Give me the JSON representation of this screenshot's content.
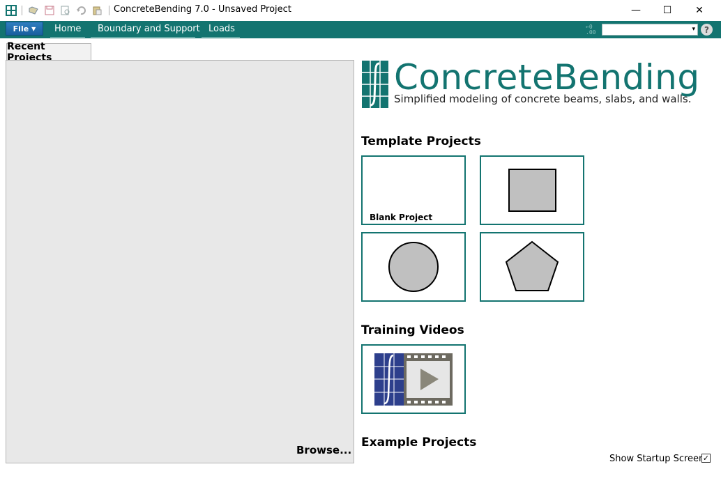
{
  "window": {
    "title": "ConcreteBending 7.0 - Unsaved Project",
    "minimize_glyph": "—",
    "maximize_glyph": "☐",
    "close_glyph": "✕"
  },
  "quick_access": [
    "app-icon",
    "open-icon",
    "save-icon",
    "print-preview-icon",
    "undo-icon",
    "paste-icon"
  ],
  "ribbon": {
    "file_label": "File",
    "tabs": [
      "Home",
      "Boundary and Support",
      "Loads"
    ],
    "units_combo_value": "",
    "help_glyph": "?",
    "decimal_glyph_top": "←0",
    "decimal_glyph_bottom": ".00",
    "accent_color": "#137470"
  },
  "recent": {
    "tab_label": "Recent Projects",
    "browse_label": "Browse..."
  },
  "logo": {
    "name": "ConcreteBending",
    "tagline": "Simplified modeling of concrete beams, slabs, and walls."
  },
  "templates": {
    "title": "Template Projects",
    "items": [
      {
        "label": "Blank Project",
        "shape": "none"
      },
      {
        "label": "",
        "shape": "rectangle"
      },
      {
        "label": "",
        "shape": "circle"
      },
      {
        "label": "",
        "shape": "pentagon"
      }
    ]
  },
  "training": {
    "title": "Training Videos"
  },
  "examples": {
    "title": "Example Projects"
  },
  "footer": {
    "show_startup_label": "Show Startup Screen?",
    "show_startup_checked": true,
    "check_glyph": "✓"
  }
}
